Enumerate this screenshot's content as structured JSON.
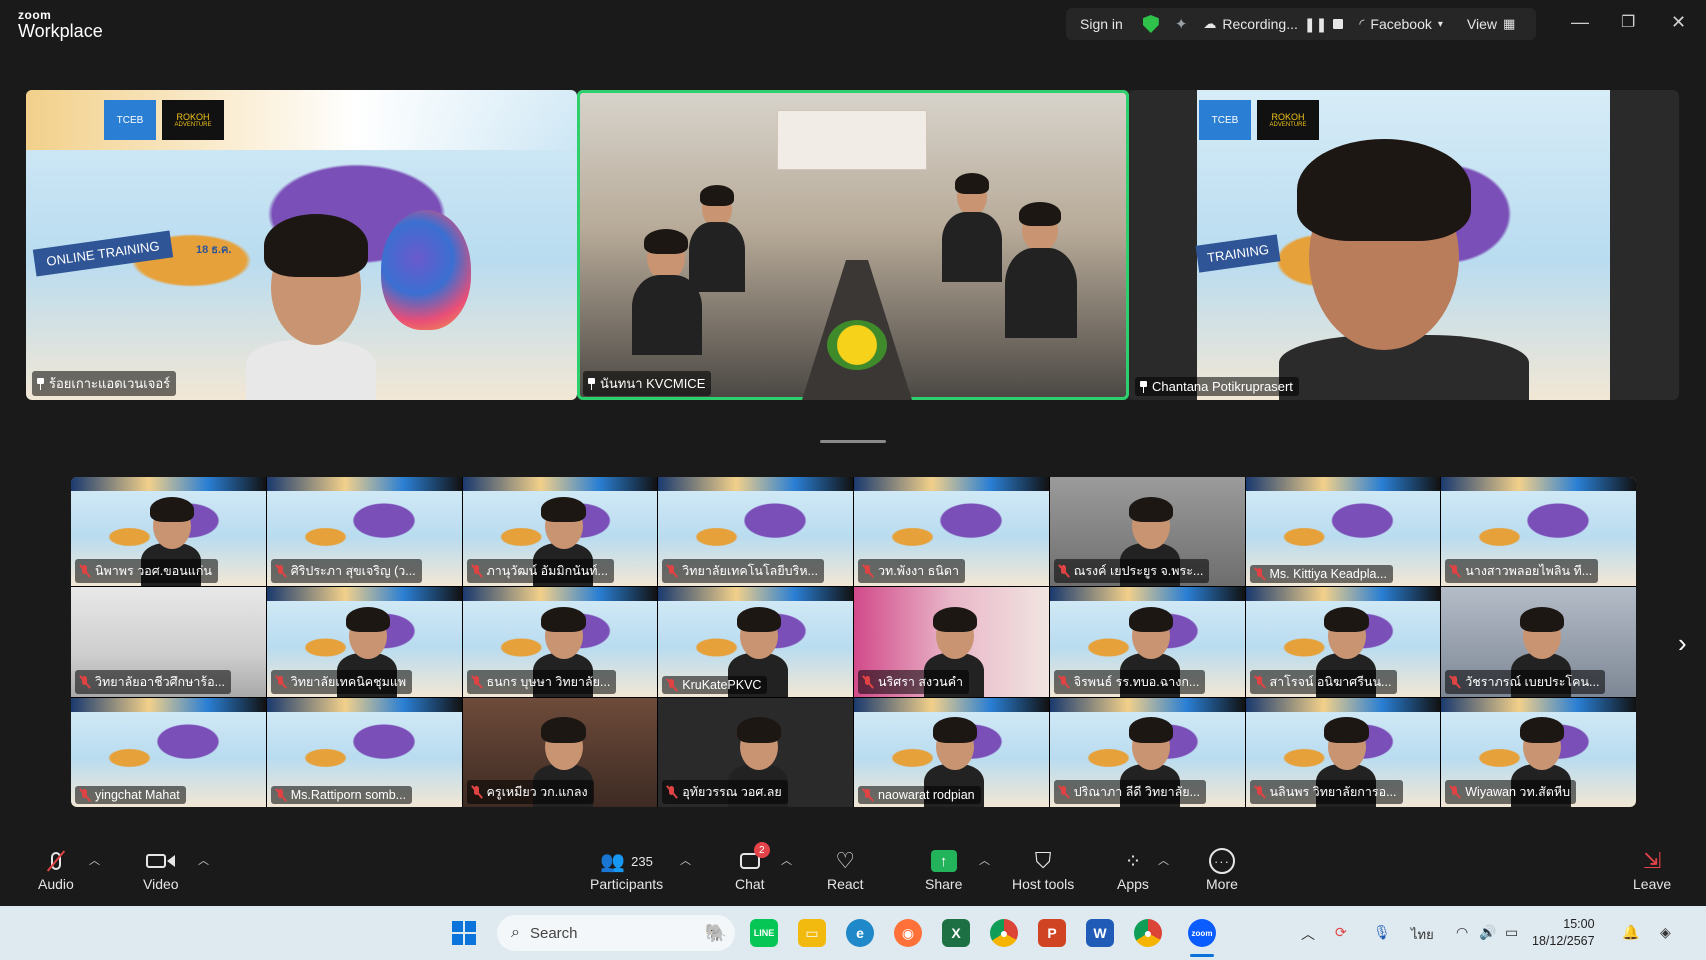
{
  "window": {
    "brand_line1": "zoom",
    "brand_line2": "Workplace",
    "sign_in": "Sign in",
    "recording": "Recording...",
    "live_target": "Facebook",
    "view": "View"
  },
  "speakers": [
    {
      "name": "ร้อยเกาะแอดเวนเจอร์",
      "active": false
    },
    {
      "name": "นันทนา KVCMICE",
      "active": true
    },
    {
      "name": "Chantana Potikruprasert",
      "active": false
    }
  ],
  "speaker_overlay_text": {
    "online_training": "ONLINE TRAINING",
    "training": "TRAINING",
    "tceb": "TCEB",
    "rokoh": "ROKOH",
    "adventure": "ADVENTURE",
    "date_snippet": "18 ธ.ค."
  },
  "gallery": [
    {
      "name": "นิพาพร วอศ.ขอนแก่น",
      "bg": "balloon",
      "face": true
    },
    {
      "name": "ศิริประภา สุขเจริญ (ว...",
      "bg": "balloon",
      "face": false
    },
    {
      "name": "ภานุวัฒน์ อัมมิกนันท์...",
      "bg": "balloon",
      "face": true
    },
    {
      "name": "วิทยาลัยเทคโนโลยีบริห...",
      "bg": "balloon",
      "face": false
    },
    {
      "name": "วท.พังงา ธนิดา",
      "bg": "balloon",
      "face": false
    },
    {
      "name": "ณรงค์ เยประยูร จ.พระ...",
      "bg": "office",
      "face": true
    },
    {
      "name": "Ms. Kittiya Keadpla...",
      "bg": "balloon",
      "face": false
    },
    {
      "name": "นางสาวพลอยไพลิน ที...",
      "bg": "balloon",
      "face": false
    },
    {
      "name": "วิทยาลัยอาชีวศึกษาร้อ...",
      "bg": "class",
      "face": false
    },
    {
      "name": "วิทยาลัยเทคนิคชุมแพ",
      "bg": "balloon",
      "face": true
    },
    {
      "name": "ธนกร บุษษา วิทยาลัย...",
      "bg": "balloon",
      "face": true
    },
    {
      "name": "KruKatePKVC",
      "bg": "balloon",
      "face": true
    },
    {
      "name": "นริศรา สงวนคำ",
      "bg": "pink",
      "face": true
    },
    {
      "name": "จิรพนธ์ รร.ทบอ.ฉางก...",
      "bg": "balloon",
      "face": true
    },
    {
      "name": "สาโรจน์ อนิฆาศรีนน...",
      "bg": "balloon",
      "face": true
    },
    {
      "name": "วัชราภรณ์ เบยประโคน...",
      "bg": "blur",
      "face": true
    },
    {
      "name": "yingchat Mahat",
      "bg": "balloon",
      "face": false
    },
    {
      "name": "Ms.Rattiporn somb...",
      "bg": "balloon",
      "face": false
    },
    {
      "name": "ครูเหมียว วก.แกลง",
      "bg": "brown",
      "face": true
    },
    {
      "name": "อุทัยวรรณ วอศ.ลย",
      "bg": "dark",
      "face": true
    },
    {
      "name": "naowarat rodpian",
      "bg": "balloon",
      "face": true
    },
    {
      "name": "ปริณาภา ลีดี วิทยาลัย...",
      "bg": "balloon",
      "face": true
    },
    {
      "name": "นลินพร วิทยาลัยการอ...",
      "bg": "balloon",
      "face": true
    },
    {
      "name": "Wiyawan วท.สัตหีบ",
      "bg": "balloon",
      "face": true
    }
  ],
  "toolbar": {
    "audio": "Audio",
    "video": "Video",
    "participants": "Participants",
    "participants_count": "235",
    "chat": "Chat",
    "chat_badge": "2",
    "react": "React",
    "share": "Share",
    "host_tools": "Host tools",
    "apps": "Apps",
    "more": "More",
    "leave": "Leave"
  },
  "taskbar": {
    "search_placeholder": "Search",
    "language": "ไทย",
    "time": "15:00",
    "date": "18/12/2567"
  },
  "colors": {
    "active_speaker_border": "#2ed06e",
    "muted_icon": "#e04343",
    "share_green": "#23b35a",
    "secure_shield": "#2ec24a"
  }
}
